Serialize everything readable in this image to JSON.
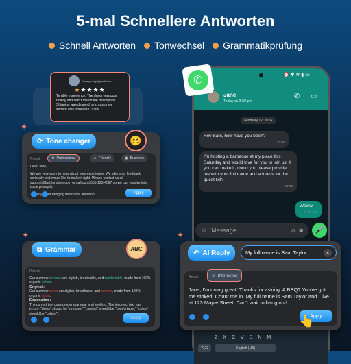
{
  "title": "5-mal Schnellere Antworten",
  "features": [
    "Schnell Antworten",
    "Tonwechsel",
    "Grammatikprüfung"
  ],
  "colors": {
    "accent": "#1b8ef0",
    "bullet": "#f5a04a",
    "whatsapp": "#128c7e"
  },
  "review": {
    "email": "Jane.young@gmail.com",
    "rating": 1,
    "max_rating": 5,
    "text": "Terrible experience. The dress was poor quality and didn't match the description. Shipping was delayed, and customer service was unhelpful. 1 star."
  },
  "tone": {
    "label": "Tone changer",
    "result_label": "Result:",
    "options": [
      "Professional",
      "Friendly",
      "Business"
    ],
    "selected": "Professional",
    "greeting": "Dear Jane,",
    "body": "We are very sorry to hear about your experience. We take your feedback seriously and would like to make it right. Please contact us at support@fashionstore.com or call us at 555-123-4567 so we can resolve this issue promptly.",
    "closing": "Thank you for bringing this to our attention.",
    "apply": "Apply"
  },
  "grammar": {
    "label": "Grammar",
    "result_label": "Result:",
    "corrected": [
      "Our summer ",
      "dresses",
      " are stylish, breathable, and ",
      "comfortable",
      ", made from 100% organic ",
      "cotton",
      "."
    ],
    "original_label": "Original :",
    "original": [
      "Our summer ",
      "dress",
      " are stylish, breathable, and ",
      "comfort",
      ", made from 100% organic ",
      "coton",
      "."
    ],
    "explanation_label": "Explanation :",
    "explanation": "The correct text uses proper grammar and spelling. The incorrect text has errors (\"dress\" should be \"dresses,\" \"comfort\" should be \"comfortable,\" \"coton\" should be \"cotton\").",
    "apply": "Apply"
  },
  "chat": {
    "contact": "Jane",
    "status": "Today at 2:30 pm",
    "date": "February 12, 2024",
    "messages": [
      {
        "text": "Hey Sam, how have you been?",
        "time": "17:00",
        "out": false
      },
      {
        "text": "I'm hosting a barbecue at my place this Saturday and would love for you to join us. If you can make it, could you please provide me with your full name and address for the guest list?",
        "time": "17:00",
        "out": false
      },
      {
        "text": "Woww",
        "time": "17:02",
        "out": true
      }
    ],
    "input_placeholder": "Message"
  },
  "ai_reply": {
    "label": "AI Reply",
    "input": "My full name is Sam Taylor",
    "result_label": "Result:",
    "tone": "Interested",
    "text": "Jane, I'm doing great! Thanks for asking. A BBQ? You've got me stoked! Count me in. My full name is Sam Taylor and I live at 123 Maple Street. Can't wait to hang out!",
    "apply": "Apply"
  },
  "keyboard": {
    "row": [
      "Z",
      "X",
      "C",
      "V",
      "B",
      "N",
      "M"
    ],
    "num": "?123",
    "space": "English (US)"
  }
}
